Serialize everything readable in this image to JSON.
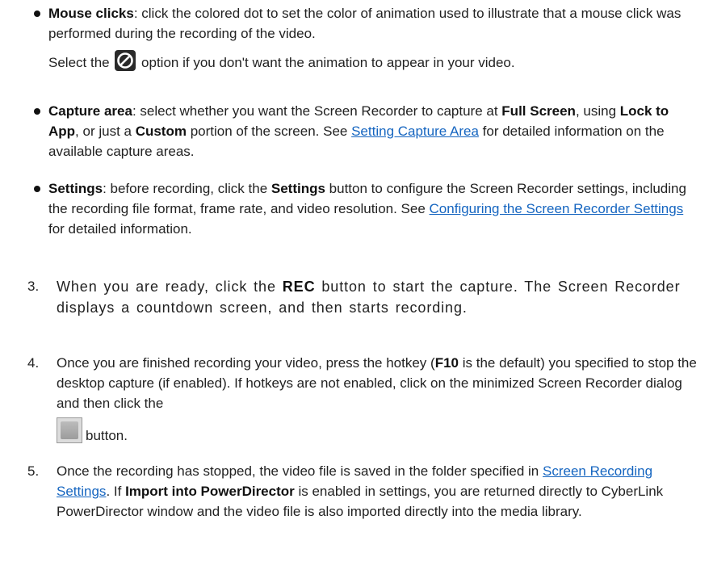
{
  "bullets": [
    {
      "title": "Mouse clicks",
      "text": ": click the colored dot to set the color of animation used to illustrate that a mouse click was performed during the recording of the video.",
      "line2_a": "Select the ",
      "icon": "no-symbol-icon",
      "line2_b": " option if you don't want the animation to appear in your video."
    },
    {
      "title": "Capture area",
      "t1": ": select whether you want the Screen Recorder to capture at ",
      "b1": "Full Screen",
      "t2": ", using ",
      "b2": "Lock to App",
      "t3": ", or just a ",
      "b3": "Custom",
      "t4": " portion of the screen. See ",
      "link": "Setting Capture Area",
      "t5": " for detailed information on the available capture areas."
    },
    {
      "title": "Settings",
      "t1": ": before recording, click the ",
      "b1": "Settings",
      "t2": " button to configure the Screen Recorder settings, including the recording file format, frame rate, and video resolution. See ",
      "link": "Configuring the Screen Recorder Settings",
      "t3": " for detailed information."
    }
  ],
  "steps": [
    {
      "num": "3.",
      "t1": "When you are ready, click the ",
      "b1": "REC",
      "t2": " button to start the capture. The Screen Recorder displays a countdown screen, and then starts recording."
    },
    {
      "num": "4.",
      "t1": "Once you are finished recording your video, press the hotkey (",
      "b1": "F10",
      "t2": " is the default) you specified to stop the desktop capture (if enabled). If hotkeys are not enabled, click on the minimized Screen Recorder dialog and then click the",
      "icon": "stop-button-icon",
      "t3": "button."
    },
    {
      "num": "5.",
      "t1": "Once the recording has stopped, the video file is saved in the folder specified in ",
      "link": "Screen Recording Settings",
      "t2": ". If ",
      "b1": "Import into PowerDirector",
      "t3": " is enabled in settings, you are returned directly to CyberLink PowerDirector window and the video file is also imported directly into the media library."
    }
  ]
}
